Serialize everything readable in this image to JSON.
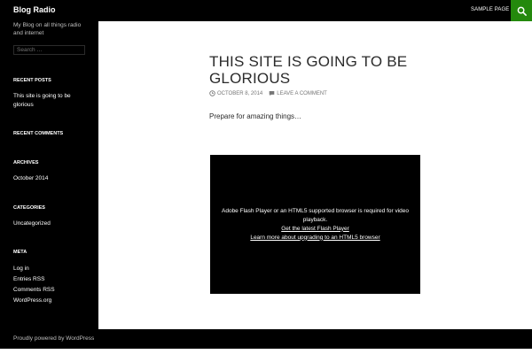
{
  "header": {
    "site_title": "Blog Radio",
    "nav_sample": "SAMPLE PAGE",
    "search_icon": "search-icon",
    "accent_color": "#24890d"
  },
  "sidebar": {
    "tagline": "My Blog on all things radio and internet",
    "search_placeholder": "Search …",
    "recent_posts": {
      "title": "RECENT POSTS",
      "items": [
        "This site is going to be glorious"
      ]
    },
    "recent_comments": {
      "title": "RECENT COMMENTS"
    },
    "archives": {
      "title": "ARCHIVES",
      "items": [
        "October 2014"
      ]
    },
    "categories": {
      "title": "CATEGORIES",
      "items": [
        "Uncategorized"
      ]
    },
    "meta": {
      "title": "META",
      "items": [
        "Log in",
        "Entries RSS",
        "Comments RSS",
        "WordPress.org"
      ]
    }
  },
  "post": {
    "title": "THIS SITE IS GOING TO BE GLORIOUS",
    "date": "OCTOBER 8, 2014",
    "comment_link": "LEAVE A COMMENT",
    "body": "Prepare for amazing things…",
    "video": {
      "message": "Adobe Flash Player or an HTML5 supported browser is required for video playback.",
      "link_flash": "Get the latest Flash Player",
      "link_html5": "Learn more about upgrading to an HTML5 browser"
    }
  },
  "footer": {
    "text": "Proudly powered by WordPress"
  }
}
